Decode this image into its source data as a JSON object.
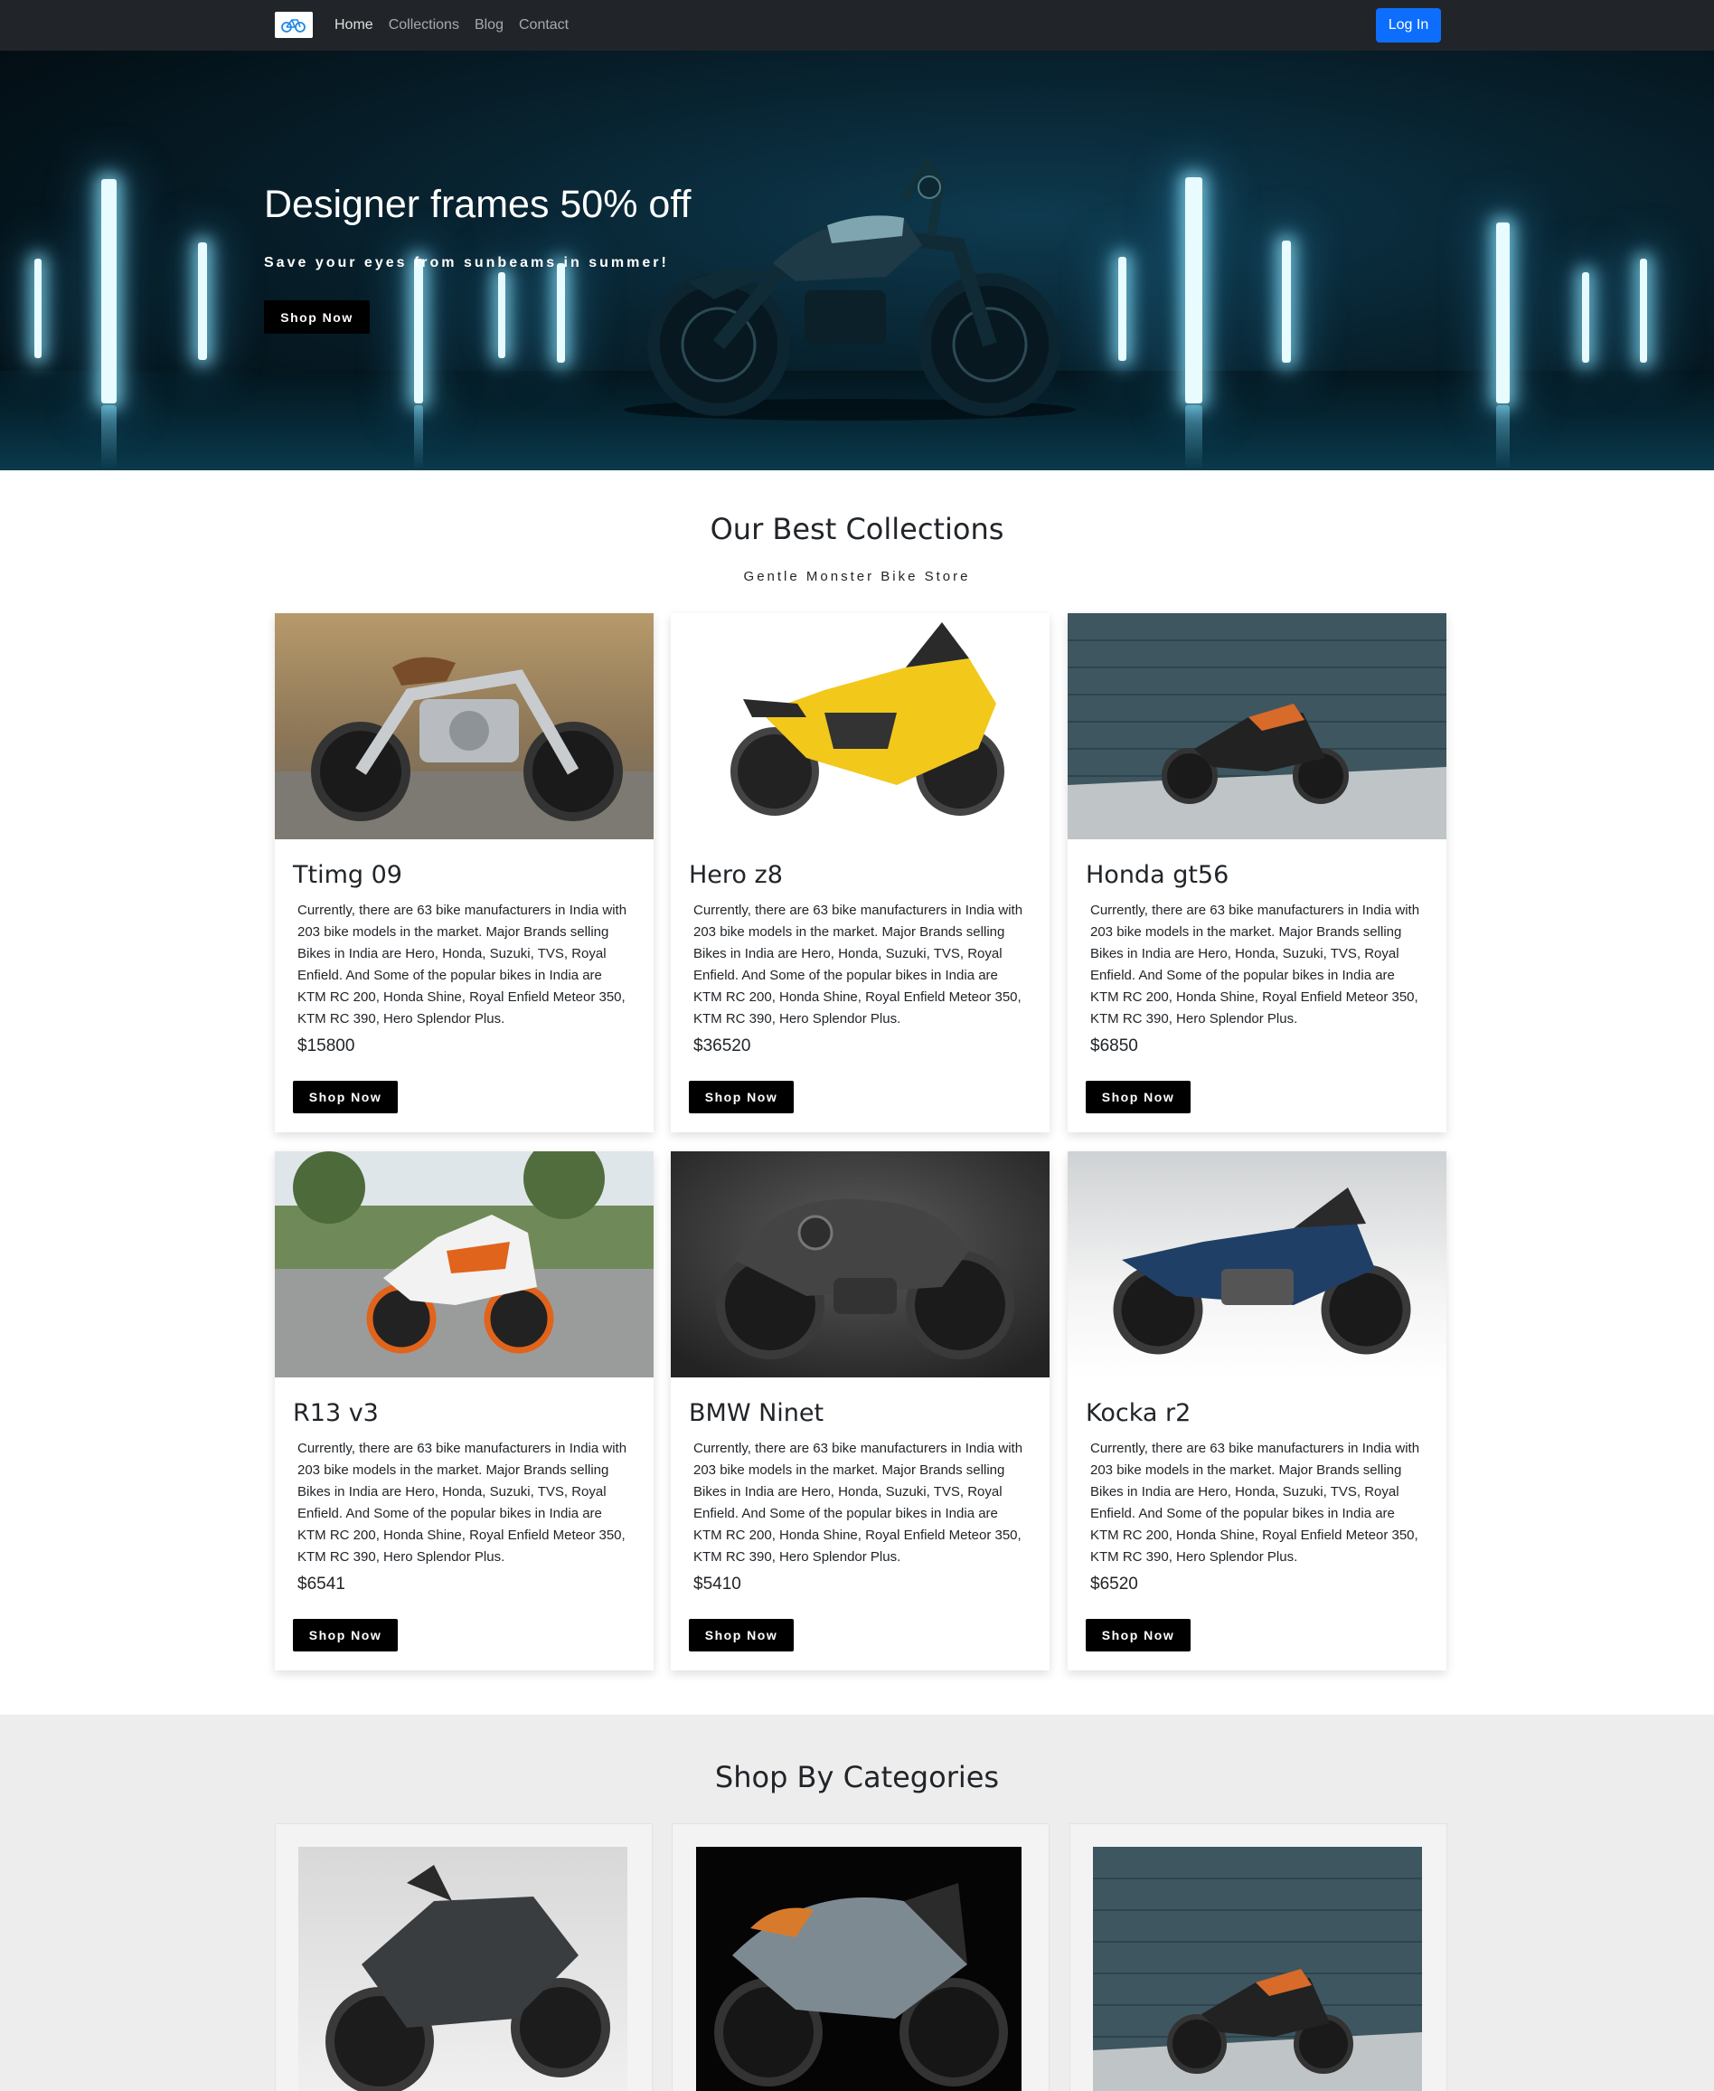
{
  "navbar": {
    "links": [
      "Home",
      "Collections",
      "Blog",
      "Contact"
    ],
    "login_label": "Log In"
  },
  "hero": {
    "title": "Designer frames 50% off",
    "subtitle": "Save your eyes from sunbeams in summer!",
    "button_label": "Shop Now"
  },
  "collections": {
    "title": "Our Best Collections",
    "subtitle": "Gentle Monster Bike Store",
    "products": [
      {
        "name": "Ttimg 09",
        "description": "Currently, there are 63 bike manufacturers in India with 203 bike models in the market. Major Brands selling Bikes in India are Hero, Honda, Suzuki, TVS, Royal Enfield. And Some of the popular bikes in India are KTM RC 200, Honda Shine, Royal Enfield Meteor 350, KTM RC 390, Hero Splendor Plus.",
        "price": "$15800",
        "button_label": "Shop Now"
      },
      {
        "name": "Hero z8",
        "description": "Currently, there are 63 bike manufacturers in India with 203 bike models in the market. Major Brands selling Bikes in India are Hero, Honda, Suzuki, TVS, Royal Enfield. And Some of the popular bikes in India are KTM RC 200, Honda Shine, Royal Enfield Meteor 350, KTM RC 390, Hero Splendor Plus.",
        "price": "$36520",
        "button_label": "Shop Now"
      },
      {
        "name": "Honda gt56",
        "description": "Currently, there are 63 bike manufacturers in India with 203 bike models in the market. Major Brands selling Bikes in India are Hero, Honda, Suzuki, TVS, Royal Enfield. And Some of the popular bikes in India are KTM RC 200, Honda Shine, Royal Enfield Meteor 350, KTM RC 390, Hero Splendor Plus.",
        "price": "$6850",
        "button_label": "Shop Now"
      },
      {
        "name": "R13 v3",
        "description": "Currently, there are 63 bike manufacturers in India with 203 bike models in the market. Major Brands selling Bikes in India are Hero, Honda, Suzuki, TVS, Royal Enfield. And Some of the popular bikes in India are KTM RC 200, Honda Shine, Royal Enfield Meteor 350, KTM RC 390, Hero Splendor Plus.",
        "price": "$6541",
        "button_label": "Shop Now"
      },
      {
        "name": "BMW Ninet",
        "description": "Currently, there are 63 bike manufacturers in India with 203 bike models in the market. Major Brands selling Bikes in India are Hero, Honda, Suzuki, TVS, Royal Enfield. And Some of the popular bikes in India are KTM RC 200, Honda Shine, Royal Enfield Meteor 350, KTM RC 390, Hero Splendor Plus.",
        "price": "$5410",
        "button_label": "Shop Now"
      },
      {
        "name": "Kocka r2",
        "description": "Currently, there are 63 bike manufacturers in India with 203 bike models in the market. Major Brands selling Bikes in India are Hero, Honda, Suzuki, TVS, Royal Enfield. And Some of the popular bikes in India are KTM RC 200, Honda Shine, Royal Enfield Meteor 350, KTM RC 390, Hero Splendor Plus.",
        "price": "$6520",
        "button_label": "Shop Now"
      }
    ]
  },
  "categories": {
    "title": "Shop By Categories"
  },
  "colors": {
    "navbar_bg": "#212529",
    "login_btn": "#0d6efd",
    "button_bg": "#000000",
    "categories_bg": "#ededed"
  },
  "icons": {
    "brand_logo": "bicycle-logo-icon"
  }
}
